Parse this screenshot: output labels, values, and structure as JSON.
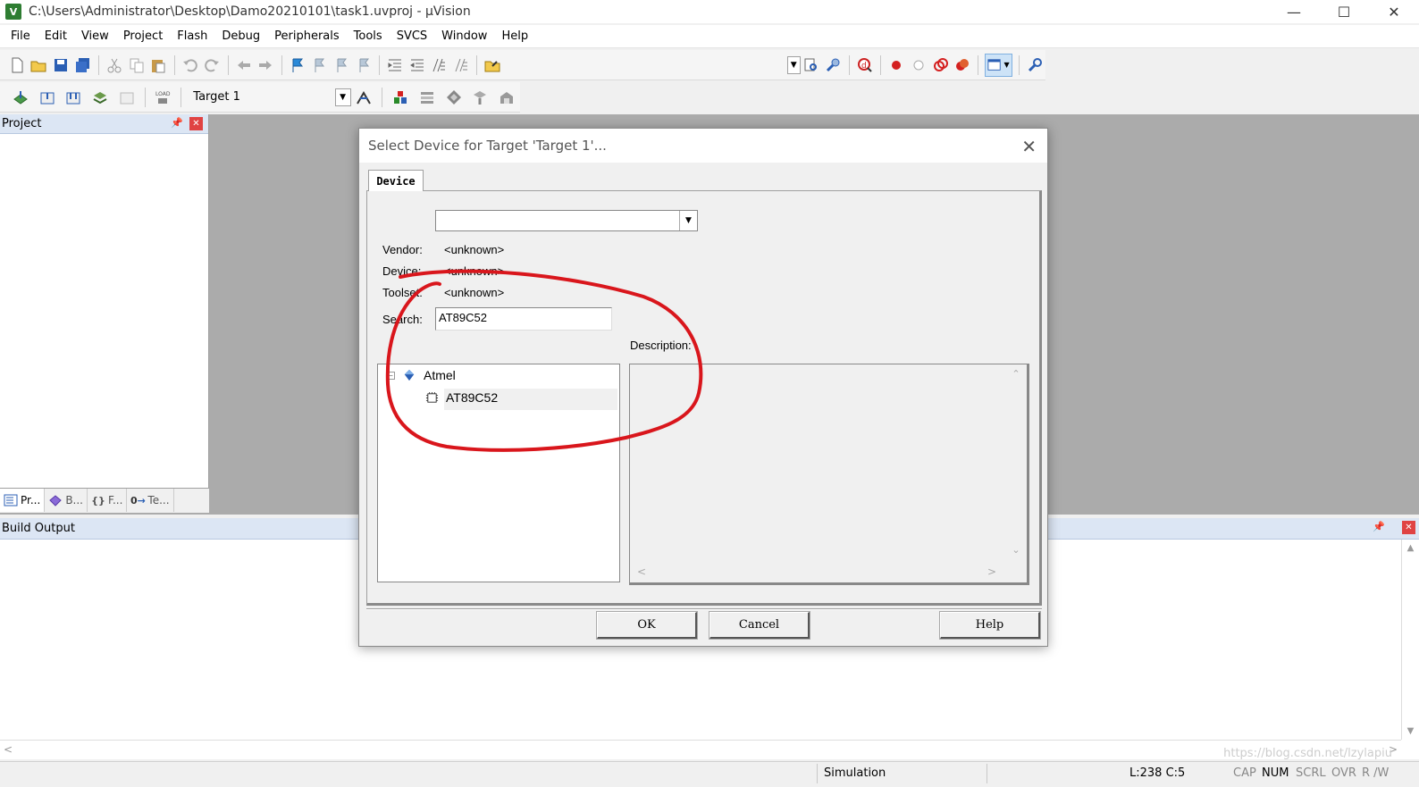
{
  "window": {
    "title": "C:\\Users\\Administrator\\Desktop\\Damo20210101\\task1.uvproj - µVision",
    "app_icon_letter": "V"
  },
  "menu": [
    "File",
    "Edit",
    "View",
    "Project",
    "Flash",
    "Debug",
    "Peripherals",
    "Tools",
    "SVCS",
    "Window",
    "Help"
  ],
  "toolbar2": {
    "target": "Target 1"
  },
  "project_pane": {
    "title": "Project",
    "tabs": [
      "Pr...",
      "B...",
      "F...",
      "Te..."
    ]
  },
  "build_output": {
    "title": "Build Output"
  },
  "status": {
    "mode": "Simulation",
    "position": "L:238 C:5",
    "indicators": [
      "CAP",
      "NUM",
      "SCRL",
      "OVR",
      "R /W"
    ],
    "watermark": "https://blog.csdn.net/lzylapiu"
  },
  "dialog": {
    "title": "Select Device for Target 'Target 1'...",
    "tab": "Device",
    "combo_value": "",
    "vendor_label": "Vendor:",
    "vendor_value": "<unknown>",
    "device_label": "Device:",
    "device_value": "<unknown>",
    "toolset_label": "Toolset:",
    "toolset_value": "<unknown>",
    "search_label": "Search:",
    "search_value": "AT89C52",
    "description_label": "Description:",
    "tree": {
      "vendor": "Atmel",
      "device": "AT89C52"
    },
    "buttons": {
      "ok": "OK",
      "cancel": "Cancel",
      "help": "Help"
    }
  },
  "colors": {
    "pane_header": "#dce6f4",
    "workspace": "#ababab",
    "annotation_red": "#d9161c",
    "close_red": "#e04343"
  }
}
